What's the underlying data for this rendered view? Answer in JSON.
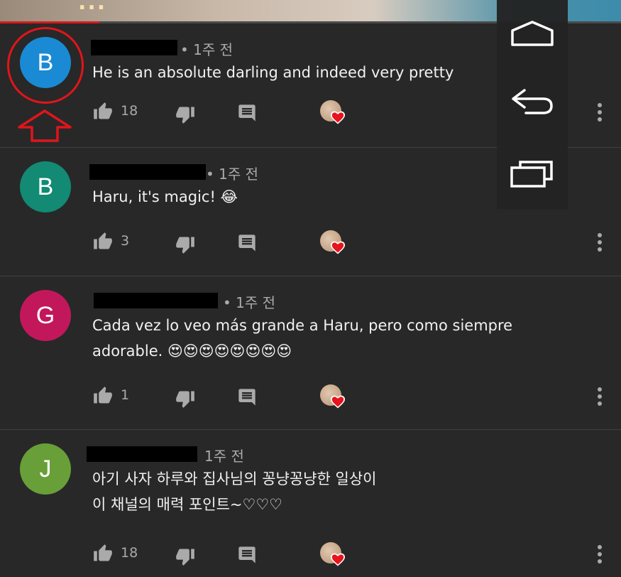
{
  "video": {
    "caption": "..."
  },
  "progress": {
    "fraction": 0.16
  },
  "nav": {
    "icons": [
      "home-icon",
      "back-icon",
      "recent-apps-icon"
    ]
  },
  "comments": [
    {
      "avatar_letter": "B",
      "avatar_color": "#1a8ad4",
      "time": "• 1주 전",
      "text_lines": [
        "He is an absolute darling and indeed very pretty"
      ],
      "likes": "18"
    },
    {
      "avatar_letter": "B",
      "avatar_color": "#128a74",
      "time": "• 1주 전",
      "text_lines": [
        "Haru, it's magic! 😂"
      ],
      "likes": "3"
    },
    {
      "avatar_letter": "G",
      "avatar_color": "#c2185b",
      "time": "• 1주 전",
      "text_lines": [
        "Cada vez lo veo más grande a Haru, pero como siempre",
        "adorable. 😍😍😍😍😍😍😍😍"
      ],
      "likes": "1"
    },
    {
      "avatar_letter": "J",
      "avatar_color": "#689f38",
      "time": "1주 전",
      "text_lines": [
        "아기 사자 하루와 집사님의 꽁냥꽁냥한 일상이",
        "이 채널의 매력 포인트~♡♡♡"
      ],
      "likes": "18"
    }
  ],
  "annotation": {
    "color": "#e0151b"
  }
}
